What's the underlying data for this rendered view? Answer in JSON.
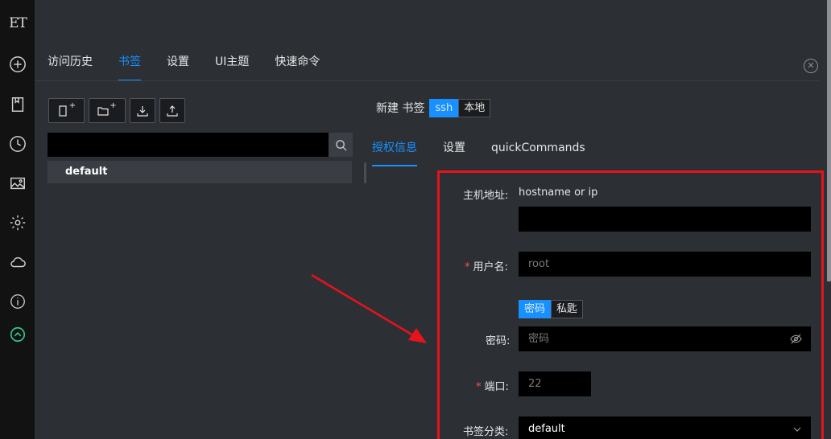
{
  "sidebar": {
    "logo": "ET",
    "icons": [
      "plus-circle-icon",
      "book-icon",
      "clock-icon",
      "image-icon",
      "gear-icon",
      "cloud-icon",
      "info-icon",
      "up-circle-icon"
    ]
  },
  "tabs": [
    {
      "label": "访问历史"
    },
    {
      "label": "书签"
    },
    {
      "label": "设置"
    },
    {
      "label": "UI主题"
    },
    {
      "label": "快速命令"
    }
  ],
  "close_glyph": "✕",
  "tree": {
    "search_placeholder": "",
    "items": [
      {
        "label": "default"
      }
    ]
  },
  "new_bookmark": {
    "title": "新建 书签",
    "types": [
      {
        "label": "ssh",
        "active": true
      },
      {
        "label": "本地",
        "active": false
      }
    ]
  },
  "subtabs": [
    {
      "label": "授权信息"
    },
    {
      "label": "设置"
    },
    {
      "label": "quickCommands"
    }
  ],
  "form": {
    "host_label": "主机地址:",
    "host_hint": "hostname or ip",
    "host_value": "",
    "username_label": "用户名:",
    "username_placeholder": "root",
    "auth_types": [
      {
        "label": "密码",
        "active": true
      },
      {
        "label": "私匙",
        "active": false
      }
    ],
    "password_label": "密码:",
    "password_placeholder": "密码",
    "port_label": "端口:",
    "port_placeholder": "22",
    "category_label": "书签分类:",
    "category_value": "default",
    "required_mark": "*"
  },
  "colors": {
    "accent": "#1890ff",
    "highlight_box": "#e8121b",
    "arrow": "#e8121b"
  }
}
